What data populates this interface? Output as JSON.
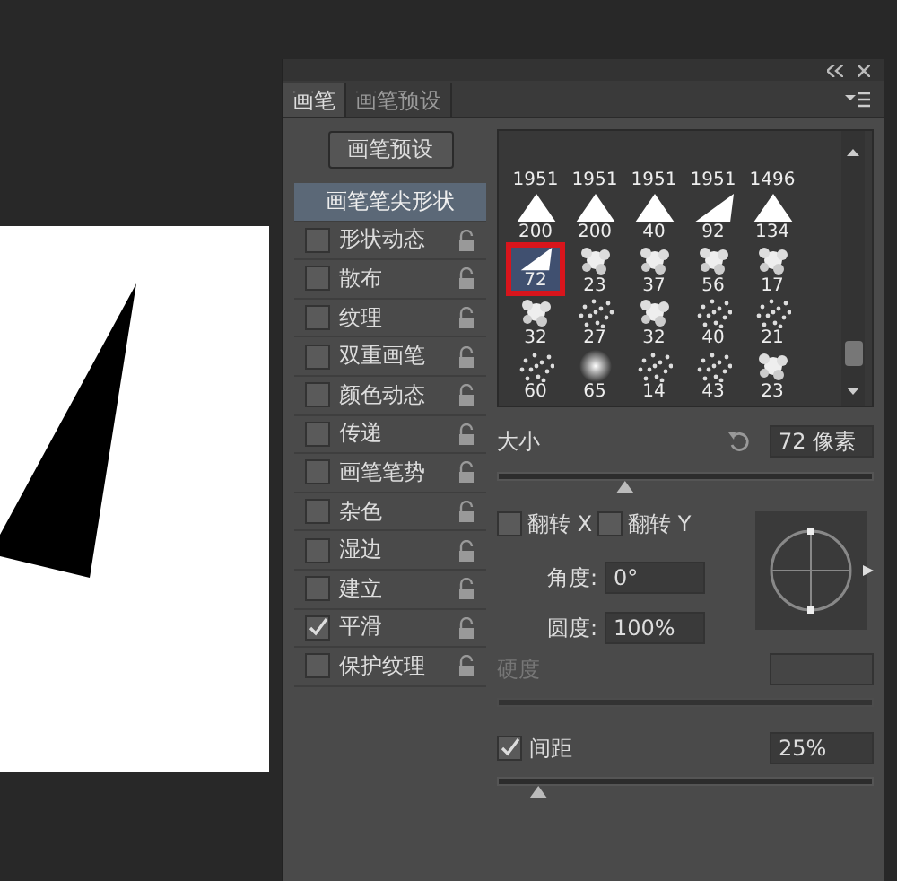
{
  "panel": {
    "tabs": [
      {
        "label": "画笔",
        "selected": true
      },
      {
        "label": "画笔预设",
        "selected": false
      }
    ],
    "preset_button": "画笔预设",
    "options": [
      {
        "kind": "tip",
        "label": "画笔笔尖形状",
        "selected": true
      },
      {
        "kind": "option",
        "label": "形状动态",
        "checked": false,
        "selected": false
      },
      {
        "kind": "option",
        "label": "散布",
        "checked": false,
        "selected": false
      },
      {
        "kind": "option",
        "label": "纹理",
        "checked": false,
        "selected": false
      },
      {
        "kind": "option",
        "label": "双重画笔",
        "checked": false,
        "selected": false
      },
      {
        "kind": "option",
        "label": "颜色动态",
        "checked": false,
        "selected": false
      },
      {
        "kind": "option",
        "label": "传递",
        "checked": false,
        "selected": false
      },
      {
        "kind": "option",
        "label": "画笔笔势",
        "checked": false,
        "selected": false
      },
      {
        "kind": "option",
        "label": "杂色",
        "checked": false,
        "selected": false
      },
      {
        "kind": "option",
        "label": "湿边",
        "checked": false,
        "selected": false
      },
      {
        "kind": "option",
        "label": "建立",
        "checked": false,
        "selected": false
      },
      {
        "kind": "option",
        "label": "平滑",
        "checked": true,
        "selected": false
      },
      {
        "kind": "option",
        "label": "保护纹理",
        "checked": false,
        "selected": false
      }
    ],
    "tips": [
      {
        "kind": "none",
        "size": "1951",
        "selected": false
      },
      {
        "kind": "none",
        "size": "1951",
        "selected": false
      },
      {
        "kind": "none",
        "size": "1951",
        "selected": false
      },
      {
        "kind": "none",
        "size": "1951",
        "selected": false
      },
      {
        "kind": "none",
        "size": "1496",
        "selected": false
      },
      {
        "kind": "triangle",
        "size": "200",
        "selected": false
      },
      {
        "kind": "triangle",
        "size": "200",
        "selected": false
      },
      {
        "kind": "triangle",
        "size": "40",
        "selected": false
      },
      {
        "kind": "wedge",
        "size": "92",
        "selected": false
      },
      {
        "kind": "triangle",
        "size": "134",
        "selected": false
      },
      {
        "kind": "wedge",
        "size": "72",
        "selected": true
      },
      {
        "kind": "splatter",
        "size": "23",
        "selected": false
      },
      {
        "kind": "splatter",
        "size": "37",
        "selected": false
      },
      {
        "kind": "splatter",
        "size": "56",
        "selected": false
      },
      {
        "kind": "splatter",
        "size": "17",
        "selected": false
      },
      {
        "kind": "splatter",
        "size": "32",
        "selected": false
      },
      {
        "kind": "spray",
        "size": "27",
        "selected": false
      },
      {
        "kind": "splatter",
        "size": "32",
        "selected": false
      },
      {
        "kind": "spray",
        "size": "40",
        "selected": false
      },
      {
        "kind": "spray",
        "size": "21",
        "selected": false
      },
      {
        "kind": "spray",
        "size": "60",
        "selected": false
      },
      {
        "kind": "soft",
        "size": "65",
        "selected": false
      },
      {
        "kind": "spray",
        "size": "14",
        "selected": false
      },
      {
        "kind": "spray",
        "size": "43",
        "selected": false
      },
      {
        "kind": "splatter",
        "size": "23",
        "selected": false
      }
    ],
    "size": {
      "label": "大小",
      "value": "72 像素",
      "level": 0.34
    },
    "flip_x": {
      "label": "翻转 X",
      "checked": false
    },
    "flip_y": {
      "label": "翻转 Y",
      "checked": false
    },
    "angle": {
      "label": "角度:",
      "value": "0°"
    },
    "roundness": {
      "label": "圆度:",
      "value": "100%"
    },
    "hardness": {
      "label": "硬度",
      "disabled": true
    },
    "spacing": {
      "label": "间距",
      "checked": true,
      "value": "25%",
      "level": 0.11
    }
  }
}
